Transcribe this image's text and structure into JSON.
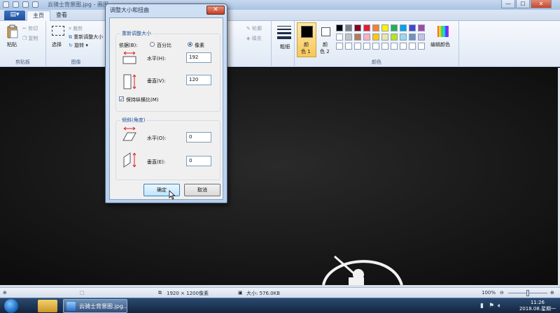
{
  "window": {
    "title": "云骑士背景图.jpg - 画图",
    "controls": {
      "minimize": "—",
      "maximize": "☐",
      "close": "✕"
    }
  },
  "ribbon": {
    "file_menu_icon": "menu-icon",
    "tabs": [
      {
        "label": "主页",
        "active": true
      },
      {
        "label": "查看",
        "active": false
      }
    ],
    "clipboard": {
      "paste": "粘贴",
      "cut": "剪切",
      "copy": "复制",
      "group": "剪贴板"
    },
    "image": {
      "select": "选择",
      "crop": "裁剪",
      "resize": "重新调整大小",
      "rotate": "旋转",
      "group": "图像"
    },
    "shapes": {
      "outline": "轮廓",
      "fill": "填充"
    },
    "size": {
      "label": "粗细"
    },
    "colors": {
      "color1_label": "颜色 1",
      "color1_line1": "颜",
      "color1_line2": "色 1",
      "color2_line1": "颜",
      "color2_line2": "色 2",
      "edit": "编辑颜色",
      "group": "颜色",
      "color1_value": "#000000",
      "color2_value": "#ffffff",
      "palette_row1": [
        "#000000",
        "#7f7f7f",
        "#880015",
        "#ed1c24",
        "#ff7f27",
        "#fff200",
        "#22b14c",
        "#00a2e8",
        "#3f48cc",
        "#a349a4"
      ],
      "palette_row2": [
        "#ffffff",
        "#c3c3c3",
        "#b97a57",
        "#ffaec9",
        "#ffc90e",
        "#efe4b0",
        "#b5e61d",
        "#99d9ea",
        "#7092be",
        "#c8bfe7"
      ]
    }
  },
  "dialog": {
    "title": "调整大小和扭曲",
    "resize_section": "重新调整大小",
    "basis_label": "依据(B):",
    "percent_option": "百分比",
    "pixels_option": "像素",
    "horizontal_label": "水平(H):",
    "horizontal_value": "192",
    "vertical_label": "垂直(V):",
    "vertical_value": "120",
    "keep_ratio_label": "保持纵横比(M)",
    "skew_section": "倾斜(角度)",
    "skew_h_label": "水平(O):",
    "skew_h_value": "0",
    "skew_v_label": "垂直(E):",
    "skew_v_value": "0",
    "ok_button": "确定",
    "cancel_button": "取消"
  },
  "status": {
    "dimensions": "1920 × 1200像素",
    "file_size": "大小: 576.0KB",
    "zoom": "100%"
  },
  "taskbar": {
    "task_label": "云骑士背景图.jpg...",
    "time": "11:26",
    "date": "2018.08.星期一"
  }
}
